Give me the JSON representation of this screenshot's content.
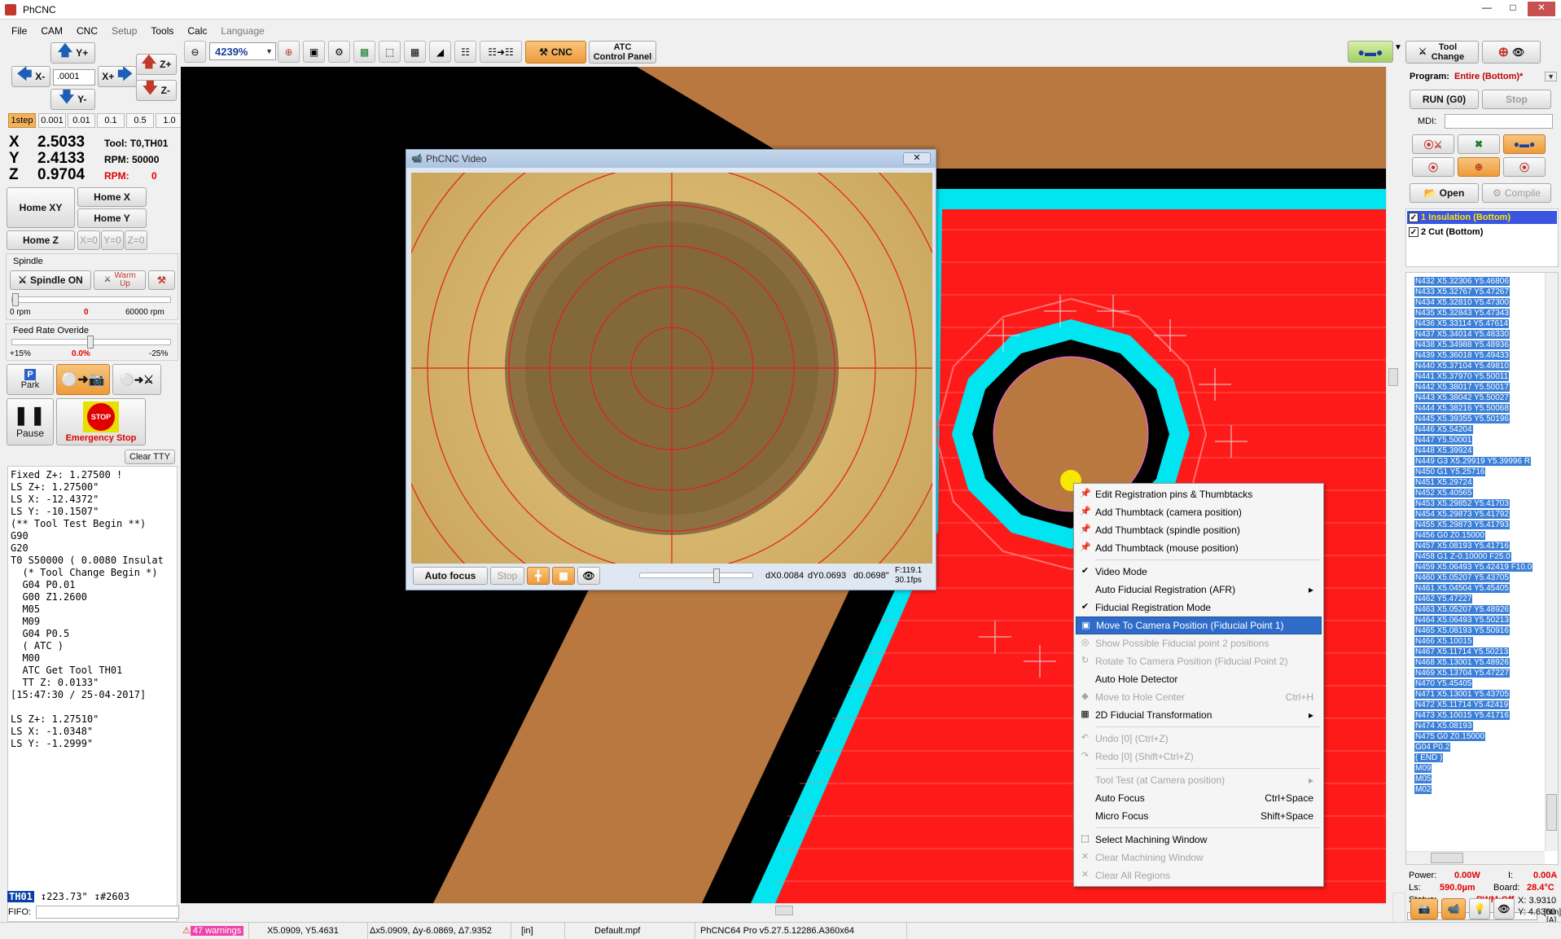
{
  "app": {
    "title": "PhCNC"
  },
  "menu": [
    "File",
    "CAM",
    "CNC",
    "Setup",
    "Tools",
    "Calc",
    "Language"
  ],
  "jog": {
    "y_plus": "Y+",
    "y_minus": "Y-",
    "x_minus": "X-",
    "x_plus": "X+",
    "z_plus": "Z+",
    "z_minus": "Z-",
    "step_value": ".0001"
  },
  "steps": [
    "1step",
    "0.001",
    "0.01",
    "0.1",
    "0.5",
    "1.0"
  ],
  "coords": {
    "x_label": "X",
    "x_val": "2.5033",
    "y_label": "Y",
    "y_val": "2.4133",
    "z_label": "Z",
    "z_val": "0.9704",
    "tool": "Tool: T0,TH01",
    "rpm": "RPM: 50000",
    "rpm2_label": "RPM:",
    "rpm2_val": "0"
  },
  "home": {
    "xy": "Home XY",
    "x": "Home X",
    "y": "Home Y",
    "z": "Home Z",
    "x0": "X=0",
    "y0": "Y=0",
    "z0": "Z=0"
  },
  "spindle": {
    "title": "Spindle",
    "on": "Spindle ON",
    "warm": "Warm Up",
    "min": "0 rpm",
    "cur": "0",
    "max": "60000 rpm",
    "level": 0.0
  },
  "feed": {
    "title": "Feed Rate Overide",
    "plus": "+15%",
    "cur": "0.0%",
    "minus": "-25%",
    "level": 0.5
  },
  "actions": {
    "park": "Park",
    "pause": "Pause",
    "estop": "Emergency Stop",
    "stop_sign": "STOP",
    "clear_tty": "Clear TTY"
  },
  "tty": [
    "Fixed Z+: 1.27500 !",
    "LS Z+: 1.27500\"",
    "LS X: -12.4372\"",
    "LS Y: -10.1507\"",
    "(** Tool Test Begin **)",
    "G90",
    "G20",
    "T0 S50000 ( 0.0080 Insulat",
    "  (* Tool Change Begin *)",
    "  G04 P0.01",
    "  G00 Z1.2600",
    "  M05",
    "  M09",
    "  G04 P0.5",
    "  ( ATC )",
    "  M00",
    "  ATC Get Tool TH01",
    "  TT Z: 0.0133\"",
    "[15:47:30 / 25-04-2017]",
    "",
    "LS Z+: 1.27510\"",
    "LS X: -1.0348\"",
    "LS Y: -1.2999\""
  ],
  "tool_status": {
    "tool": "TH01",
    "length": "223.73\"",
    "count": "#2603"
  },
  "fifo_label": "FIFO:",
  "toolbar": {
    "zoom": "4239%",
    "cnc": "CNC",
    "atc_line1": "ATC",
    "atc_line2": "Control Panel"
  },
  "video": {
    "title": "PhCNC Video",
    "autofocus": "Auto focus",
    "stop": "Stop",
    "dx": "dX0.0084",
    "dy": "dY0.0693",
    "d": "d0.0698\"",
    "f": "F:119.1",
    "fps": "30.1fps",
    "slider_level": 0.7
  },
  "context_menu": [
    {
      "label": "Edit Registration pins & Thumbtacks",
      "icon": "pin-icon",
      "disabled": false
    },
    {
      "label": "Add Thumbtack (camera position)",
      "icon": "pin-icon",
      "disabled": false
    },
    {
      "label": "Add Thumbtack (spindle position)",
      "icon": "pin-icon",
      "disabled": false
    },
    {
      "label": "Add Thumbtack (mouse position)",
      "icon": "pin-icon",
      "disabled": false
    },
    {
      "sep": true
    },
    {
      "label": "Video Mode",
      "icon": "check-icon",
      "disabled": false
    },
    {
      "label": "Auto Fiducial Registration (AFR)",
      "submenu": true,
      "disabled": false
    },
    {
      "label": "Fiducial Registration Mode",
      "icon": "check-icon",
      "disabled": false
    },
    {
      "label": "Move To Camera Position (Fiducial Point 1)",
      "icon": "camera-icon",
      "highlight": true
    },
    {
      "label": "Show Possible Fiducial point 2 positions",
      "icon": "target-icon",
      "disabled": true
    },
    {
      "label": "Rotate To Camera Position (Fiducial Point 2)",
      "icon": "rotate-icon",
      "disabled": true
    },
    {
      "label": "Auto Hole Detector",
      "disabled": false
    },
    {
      "label": "Move to Hole Center",
      "shortcut": "Ctrl+H",
      "icon": "diamond-icon",
      "disabled": true
    },
    {
      "label": "2D Fiducial Transformation",
      "submenu": true,
      "icon": "transform-icon",
      "disabled": false
    },
    {
      "sep": true
    },
    {
      "label": "Undo [0] (Ctrl+Z)",
      "icon": "undo-icon",
      "disabled": true
    },
    {
      "label": "Redo [0] (Shift+Ctrl+Z)",
      "icon": "redo-icon",
      "disabled": true
    },
    {
      "sep": true
    },
    {
      "label": "Tool Test (at Camera position)",
      "submenu": true,
      "disabled": true
    },
    {
      "label": "Auto Focus",
      "shortcut": "Ctrl+Space",
      "disabled": false
    },
    {
      "label": "Micro Focus",
      "shortcut": "Shift+Space",
      "disabled": false
    },
    {
      "sep": true
    },
    {
      "label": "Select Machining Window",
      "icon": "select-icon",
      "disabled": false
    },
    {
      "label": "Clear Machining Window",
      "icon": "x-icon",
      "disabled": true
    },
    {
      "label": "Clear All Regions",
      "icon": "x-icon",
      "disabled": true
    }
  ],
  "right": {
    "tool_change": "Tool Change",
    "program_label": "Program:",
    "program_value": "Entire (Bottom)*",
    "run": "RUN (G0)",
    "stop": "Stop",
    "mdi": "MDI:",
    "open": "Open",
    "compile": "Compile",
    "layers": [
      {
        "label": "1 Insulation (Bottom)",
        "checked": true,
        "selected": true
      },
      {
        "label": "2 Cut (Bottom)",
        "checked": true,
        "selected": false
      }
    ],
    "gcode": [
      "N432 X5.32306 Y5.46806",
      "N433 X5.32767 Y5.47267",
      "N434 X5.32810 Y5.47300",
      "N435 X5.32843 Y5.47343",
      "N436 X5.33114 Y5.47614",
      "N437 X5.34014 Y5.48330",
      "N438 X5.34988 Y5.48936",
      "N439 X5.36018 Y5.49433",
      "N440 X5.37104 Y5.49810",
      "N441 X5.37970 Y5.50011",
      "N442 X5.38017 Y5.50017",
      "N443 X5.38042 Y5.50027",
      "N444 X5.38216 Y5.50068",
      "N445 X5.39355 Y5.50196",
      "N446 X5.54204",
      "N447 Y5.50001",
      "N448 X5.39924",
      "N449 G3 X5.29919 Y5.39996 R",
      "N450 G1 Y5.25716",
      "N451 X5.29724",
      "N452 X5.40565",
      "N453 X5.29852 Y5.41703",
      "N454 X5.29873 Y5.41792",
      "N455 X5.29873 Y5.41793",
      "N456 G0 Z0.15000",
      "N457 X5.08193 Y5.41716",
      "N458 G1 Z-0.10000 F25.0",
      "N459 X5.06493 Y5.42419 F10.0",
      "N460 X5.05207 Y5.43705",
      "N461 X5.04504 Y5.45405",
      "N462 Y5.47227",
      "N463 X5.05207 Y5.48926",
      "N464 X5.06493 Y5.50213",
      "N465 X5.08193 Y5.50916",
      "N466 X5.10015",
      "N467 X5.11714 Y5.50213",
      "N468 X5.13001 Y5.48926",
      "N469 X5.13704 Y5.47227",
      "N470 Y5.45405",
      "N471 X5.13001 Y5.43705",
      "N472 X5.11714 Y5.42419",
      "N473 X5.10015 Y5.41716",
      "N474 X5.08193",
      "N475 G0 Z0.15000",
      "G04 P0.2",
      "( END )",
      "M09",
      "M05",
      "M02"
    ],
    "power_label": "Power:",
    "power_val": "0.00W",
    "i_label": "I:",
    "i_val": "0.00A",
    "ls_label": "Ls:",
    "ls_val": "590.0µm",
    "board_label": "Board:",
    "board_val": "28.4°C",
    "status_label": "Status:",
    "status_val": "PWM:Off",
    "nm": "[Nm]",
    "a": "[A]",
    "xval": "X: 3.9310",
    "yval": "Y: 4.6300"
  },
  "statusbar": {
    "warnings": "47 warnings",
    "pos": "X5.0909, Y5.4631",
    "delta": "Δx5.0909, Δy-6.0869, Δ7.9352",
    "unit": "[in]",
    "file": "Default.mpf",
    "version": "PhCNC64 Pro v5.27.5.12286.A360x64"
  },
  "colors": {
    "accent": "#2f6cc9",
    "board": "#ff1a1a",
    "copper": "#b8783f",
    "trace": "#00e5f0",
    "stop_red": "#e00000",
    "value_red": "#e00000"
  }
}
